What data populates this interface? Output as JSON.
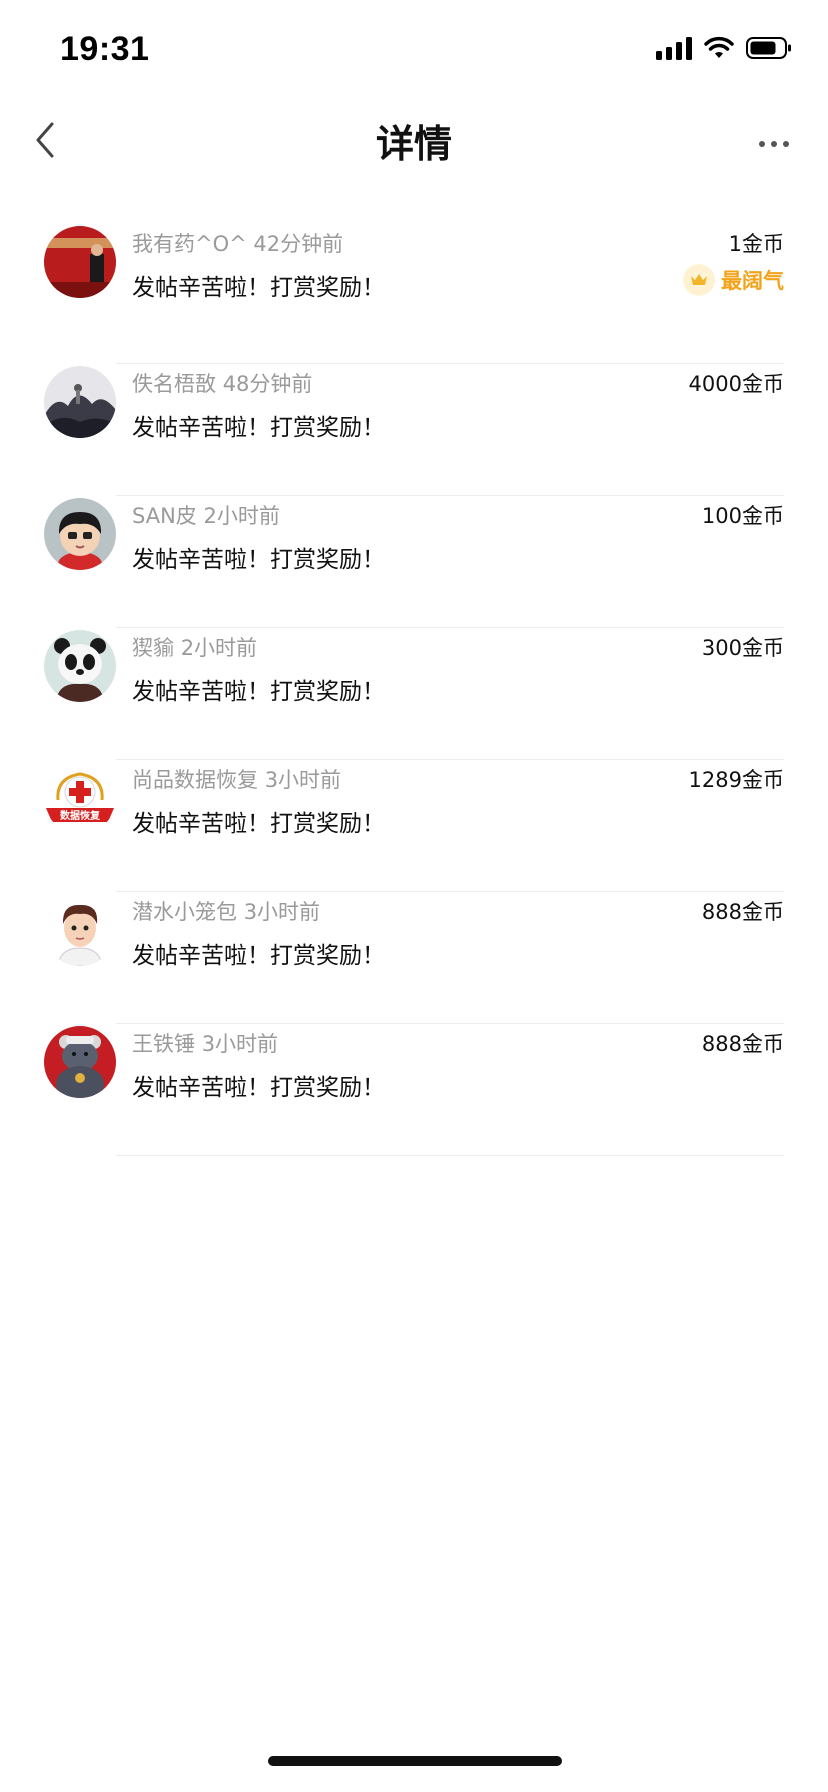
{
  "status_bar": {
    "time": "19:31"
  },
  "nav": {
    "title": "详情"
  },
  "rewards": [
    {
      "name": "我有药^O^",
      "time": "42分钟前",
      "message": "发帖辛苦啦！打赏奖励！",
      "amount": "1金币",
      "badge": "最阔气",
      "avatar": "red-photo-avatar"
    },
    {
      "name": "佚名梧敔",
      "time": "48分钟前",
      "message": "发帖辛苦啦！打赏奖励！",
      "amount": "4000金币",
      "avatar": "ink-landscape-avatar"
    },
    {
      "name": "SAN皮",
      "time": "2小时前",
      "message": "发帖辛苦啦！打赏奖励！",
      "amount": "100金币",
      "avatar": "cartoon-boy-avatar"
    },
    {
      "name": "猰貐",
      "time": "2小时前",
      "message": "发帖辛苦啦！打赏奖励！",
      "amount": "300金币",
      "avatar": "panda-avatar"
    },
    {
      "name": "尚品数据恢复",
      "time": "3小时前",
      "message": "发帖辛苦啦！打赏奖励！",
      "amount": "1289金币",
      "avatar": "data-recovery-logo-avatar",
      "avatar_text": "数据恢复"
    },
    {
      "name": "潜水小笼包",
      "time": "3小时前",
      "message": "发帖辛苦啦！打赏奖励！",
      "amount": "888金币",
      "avatar": "cartoon-man-avatar"
    },
    {
      "name": "王铁锤",
      "time": "3小时前",
      "message": "发帖辛苦啦！打赏奖励！",
      "amount": "888金币",
      "avatar": "bear-avatar"
    }
  ],
  "colors": {
    "accent": "#f3a31a",
    "divider": "#ececec",
    "meta_text": "#9a9a9a"
  }
}
